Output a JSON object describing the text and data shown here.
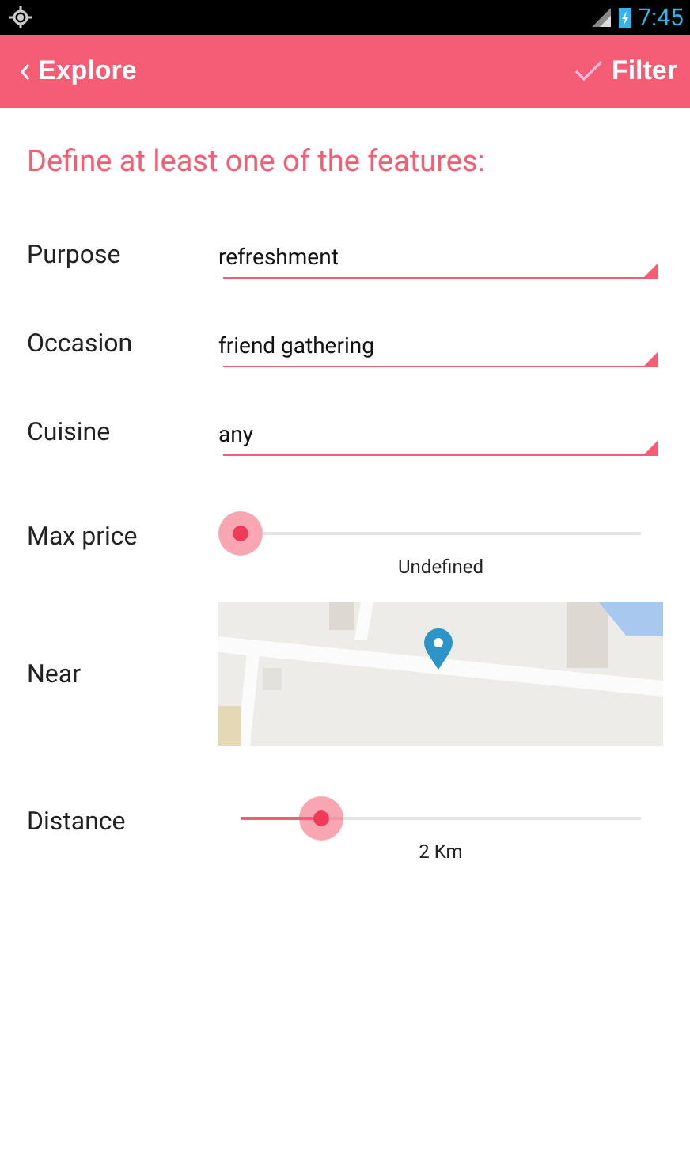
{
  "status_bar": {
    "time": "7:45"
  },
  "header": {
    "back": "Explore",
    "action": "Filter"
  },
  "heading": "Define at least one of the features:",
  "fields": [
    {
      "kind": "dropdown",
      "label": "Purpose",
      "value": "refreshment"
    },
    {
      "kind": "dropdown",
      "label": "Occasion",
      "value": "friend gathering"
    },
    {
      "kind": "dropdown",
      "label": "Cuisine",
      "value": "any"
    },
    {
      "kind": "slider",
      "label": "Max price",
      "reading": "Undefined"
    },
    {
      "kind": "map",
      "label": "Near"
    },
    {
      "kind": "slider",
      "label": "Distance",
      "level": 0.2,
      "reading": "2 Km"
    }
  ]
}
